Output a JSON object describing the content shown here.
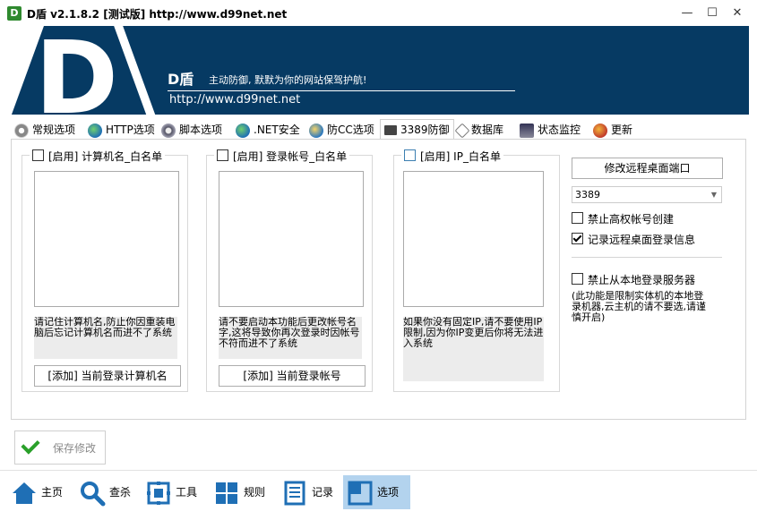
{
  "window": {
    "title": "D盾 v2.1.8.2 [测试版] http://www.d99net.net",
    "app_icon_letter": "D"
  },
  "banner": {
    "logo_letter": "D",
    "brand": "D盾",
    "slogan": "主动防御, 默默为你的网站保驾护航!",
    "url": "http://www.d99net.net",
    "bg_color": "#063a63"
  },
  "tabs": [
    {
      "label": "常规选项",
      "icon": "gear-icon"
    },
    {
      "label": "HTTP选项",
      "icon": "globe-icon"
    },
    {
      "label": "脚本选项",
      "icon": "script-gear-icon"
    },
    {
      "label": ".NET安全",
      "icon": "globe-icon"
    },
    {
      "label": "防CC选项",
      "icon": "shield-globe-icon"
    },
    {
      "label": "3389防御",
      "icon": "monitor-icon"
    },
    {
      "label": "数据库",
      "icon": "database-icon"
    },
    {
      "label": "状态监控",
      "icon": "monitor-gear-icon"
    },
    {
      "label": "更新",
      "icon": "update-icon"
    }
  ],
  "active_tab": "3389防御",
  "groups": [
    {
      "title": "[启用] 计算机名_白名单",
      "note": "请记住计算机名,防止你因重装电脑后忘记计算机名而进不了系统",
      "button": "[添加] 当前登录计算机名"
    },
    {
      "title": "[启用] 登录帐号_白名单",
      "note": "请不要启动本功能后更改帐号名字,这将导致你再次登录时因帐号不符而进不了系统",
      "button": "[添加] 当前登录帐号"
    },
    {
      "title": "[启用] IP_白名单",
      "note": "如果你没有固定IP,请不要使用IP限制,因为你IP变更后你将无法进入系统",
      "button": ""
    }
  ],
  "right": {
    "change_port_button": "修改远程桌面端口",
    "port_value": "3389",
    "options": [
      {
        "label": "禁止高权帐号创建",
        "checked": false
      },
      {
        "label": "记录远程桌面登录信息",
        "checked": true
      },
      {
        "label": "禁止从本地登录服务器",
        "checked": false
      }
    ],
    "local_login_note": "(此功能是限制实体机的本地登录机器,云主机的请不要选,请谨慎开启)"
  },
  "save_button": "保存修改",
  "nav": [
    {
      "label": "主页",
      "icon": "home-icon"
    },
    {
      "label": "查杀",
      "icon": "search-icon"
    },
    {
      "label": "工具",
      "icon": "tools-icon"
    },
    {
      "label": "规则",
      "icon": "grid-icon"
    },
    {
      "label": "记录",
      "icon": "log-icon"
    },
    {
      "label": "选项",
      "icon": "options-icon"
    }
  ],
  "active_nav": "选项",
  "colors": {
    "accent": "#1f6fb5",
    "nav_active_bg": "#b3d3ee",
    "save_check": "#2aa02a"
  }
}
